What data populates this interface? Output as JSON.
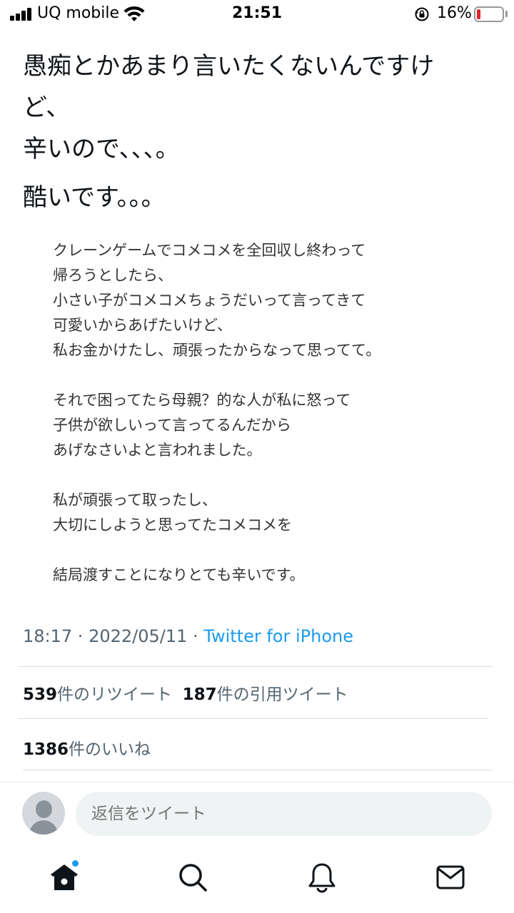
{
  "status_bar": {
    "carrier": "UQ mobile",
    "time": "21:51",
    "battery_percent": "16%",
    "battery_level": 0.16,
    "battery_color": "#e0262f",
    "icons": [
      "cellular-signal-icon",
      "wifi-icon",
      "rotation-lock-icon",
      "battery-icon"
    ]
  },
  "tweet": {
    "lines": [
      "愚痴とかあまり言いたくないんですけ",
      "ど、",
      "辛いので、、、。",
      "酷いです。。。"
    ],
    "image_text_lines": [
      "クレーンゲームでコメコメを全回収し終わって",
      "帰ろうとしたら、",
      "小さい子がコメコメちょうだいって言ってきて",
      "可愛いからあげたいけど、",
      "私お金かけたし、頑張ったからなって思ってて。",
      "",
      "それで困ってたら母親？的な人が私に怒って",
      "子供が欲しいって言ってるんだから",
      "あげなさいよと言われました。",
      "",
      "私が頑張って取ったし、",
      "大切にしようと思ってたコメコメを",
      "",
      "結局渡すことになりとても辛いです。"
    ]
  },
  "meta": {
    "time": "18:17",
    "separator": " · ",
    "date": "2022/05/11",
    "source": "Twitter for iPhone",
    "source_color": "#1d9bf0"
  },
  "stats": {
    "retweets_count": "539",
    "retweets_label": "件のリツイート",
    "quotes_count": "187",
    "quotes_label": "件の引用ツイート",
    "likes_count": "1386",
    "likes_label": "件のいいね"
  },
  "reply": {
    "placeholder": "返信をツイート"
  },
  "tab_bar": {
    "items": [
      "home-icon",
      "search-icon",
      "notifications-icon",
      "messages-icon"
    ],
    "home_has_notification_dot": true,
    "accent_color": "#1d9bf0"
  }
}
